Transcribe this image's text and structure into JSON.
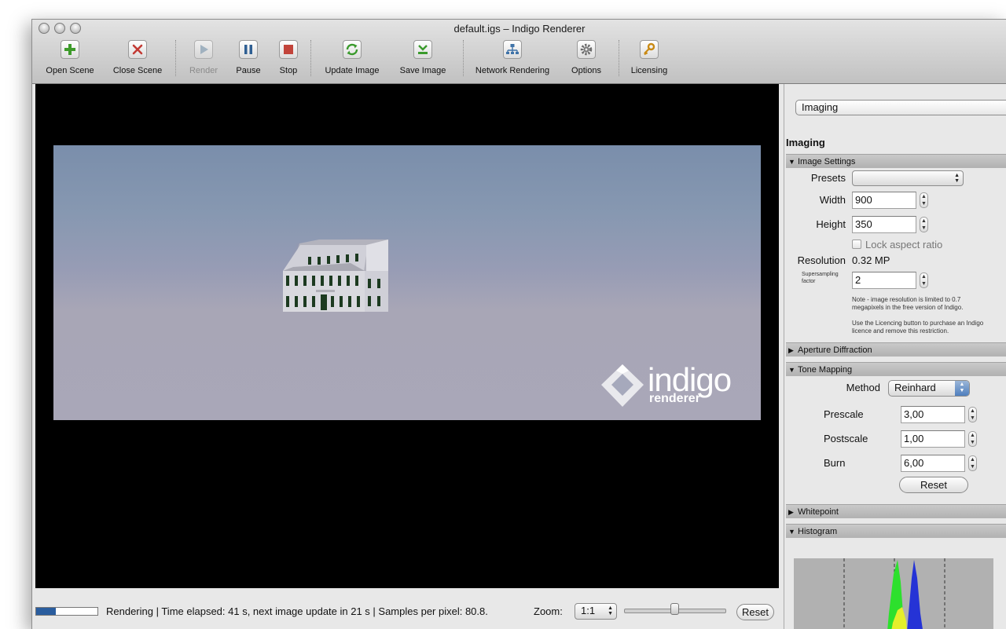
{
  "window": {
    "title": "default.igs – Indigo Renderer"
  },
  "toolbar": {
    "buttons": [
      {
        "label": "Open Scene",
        "icon": "plus-icon",
        "enabled": true
      },
      {
        "label": "Close Scene",
        "icon": "close-x-icon",
        "enabled": true
      },
      {
        "label": "Render",
        "icon": "play-icon",
        "enabled": false
      },
      {
        "label": "Pause",
        "icon": "pause-icon",
        "enabled": true
      },
      {
        "label": "Stop",
        "icon": "stop-icon",
        "enabled": true
      },
      {
        "label": "Update Image",
        "icon": "refresh-icon",
        "enabled": true
      },
      {
        "label": "Save Image",
        "icon": "download-icon",
        "enabled": true
      },
      {
        "label": "Network Rendering",
        "icon": "network-icon",
        "enabled": true
      },
      {
        "label": "Options",
        "icon": "gear-icon",
        "enabled": true
      },
      {
        "label": "Licensing",
        "icon": "key-icon",
        "enabled": true
      }
    ]
  },
  "render": {
    "watermark_main": "indigo",
    "watermark_sub": "renderer"
  },
  "status": {
    "text": "Rendering | Time elapsed: 41 s, next image update in 21 s | Samples per pixel: 80.8.",
    "progress": 0.32,
    "zoom_label": "Zoom:",
    "zoom_value": "1:1",
    "zoom_slider": 0.5,
    "reset_label": "Reset"
  },
  "panel": {
    "section_selector": "Imaging",
    "heading": "Imaging",
    "image_settings": {
      "header": "Image Settings",
      "presets_label": "Presets",
      "presets_value": "",
      "width_label": "Width",
      "width_value": "900",
      "height_label": "Height",
      "height_value": "350",
      "lock_aspect_label": "Lock aspect ratio",
      "lock_aspect_checked": false,
      "resolution_label": "Resolution",
      "resolution_value": "0.32 MP",
      "supersampling_label_line1": "Supersampling",
      "supersampling_label_line2": "factor",
      "supersampling_value": "2",
      "note_line1": "Note - image resolution is limited to 0.7",
      "note_line2": "megapixels in the free version of Indigo.",
      "note_line3": "Use the Licencing button to purchase an Indigo",
      "note_line4": "licence and remove this restriction."
    },
    "aperture_header": "Aperture Diffraction",
    "tone_mapping": {
      "header": "Tone Mapping",
      "method_label": "Method",
      "method_value": "Reinhard",
      "prescale_label": "Prescale",
      "prescale_value": "3,00",
      "postscale_label": "Postscale",
      "postscale_value": "1,00",
      "burn_label": "Burn",
      "burn_value": "6,00",
      "reset_label": "Reset"
    },
    "whitepoint_header": "Whitepoint",
    "histogram_header": "Histogram"
  },
  "colors": {
    "progress_fill": "#2a5d9e",
    "viewport_bg": "#000000",
    "histogram_blue": "#2533d6",
    "histogram_green": "#2de02d",
    "histogram_yellow": "#e4ee2c",
    "histogram_red": "#e03a2a"
  }
}
